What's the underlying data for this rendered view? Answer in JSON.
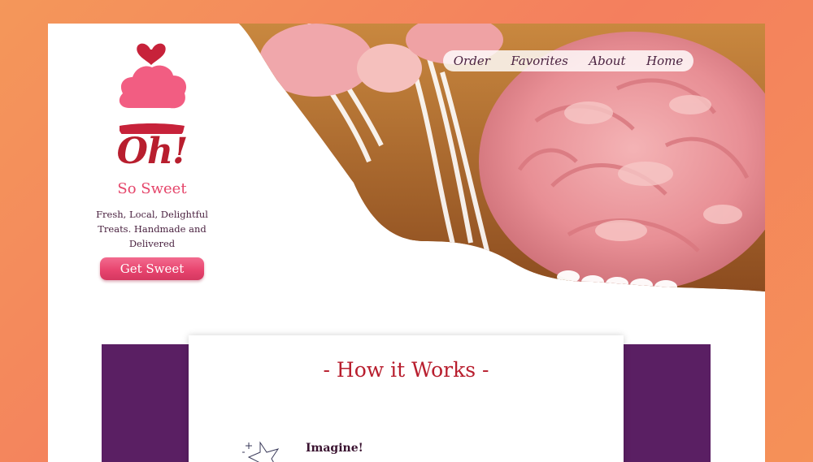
{
  "nav": {
    "items": [
      {
        "label": "Order"
      },
      {
        "label": "Favorites"
      },
      {
        "label": "About"
      },
      {
        "label": "Home"
      }
    ]
  },
  "brand": {
    "title": "Oh!",
    "subtitle": "So Sweet",
    "tagline": "Fresh, Local, Delightful Treats. Handmade and Delivered",
    "cta_label": "Get Sweet"
  },
  "how_it_works": {
    "title": "- How it Works -",
    "steps": [
      {
        "title": "Imagine!"
      }
    ]
  },
  "icons": {
    "logo": "cupcake-heart-icon",
    "step_1": "star-sparkle-icon"
  },
  "colors": {
    "brand_red": "#b81e2e",
    "brand_pink": "#e5456a",
    "purple": "#5a1f63",
    "background_orange": "#f4875c"
  }
}
